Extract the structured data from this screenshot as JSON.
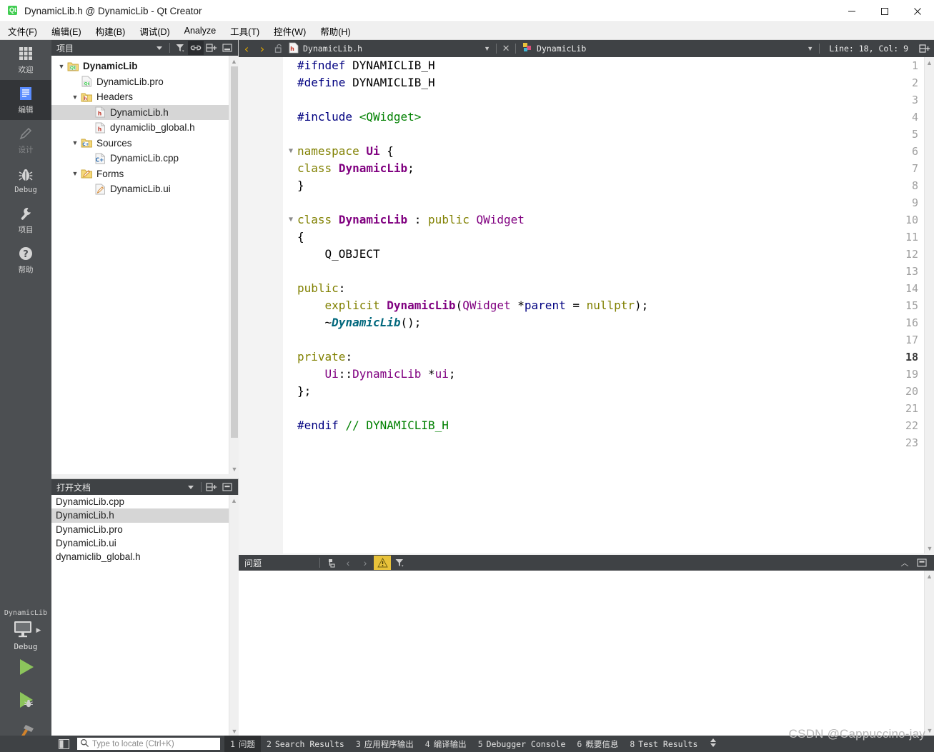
{
  "window": {
    "title": "DynamicLib.h @ DynamicLib - Qt Creator",
    "app_icon": "qt-logo-icon",
    "controls": {
      "minimize": "minimize-icon",
      "maximize": "maximize-icon",
      "close": "close-icon"
    }
  },
  "menubar": {
    "items": [
      {
        "label": "文件(F)",
        "mnemonic": "F"
      },
      {
        "label": "编辑(E)",
        "mnemonic": "E"
      },
      {
        "label": "构建(B)",
        "mnemonic": "B"
      },
      {
        "label": "调试(D)",
        "mnemonic": "D"
      },
      {
        "label": "Analyze",
        "mnemonic": "A"
      },
      {
        "label": "工具(T)",
        "mnemonic": "T"
      },
      {
        "label": "控件(W)",
        "mnemonic": "W"
      },
      {
        "label": "帮助(H)",
        "mnemonic": "H"
      }
    ]
  },
  "modebar": {
    "items": [
      {
        "label": "欢迎",
        "icon": "grid-icon",
        "selected": false,
        "enabled": true
      },
      {
        "label": "编辑",
        "icon": "document-lines-icon",
        "selected": true,
        "enabled": true
      },
      {
        "label": "设计",
        "icon": "pencil-icon",
        "selected": false,
        "enabled": false
      },
      {
        "label": "Debug",
        "icon": "bug-icon",
        "selected": false,
        "enabled": true
      },
      {
        "label": "项目",
        "icon": "wrench-icon",
        "selected": false,
        "enabled": true
      },
      {
        "label": "帮助",
        "icon": "question-circle-icon",
        "selected": false,
        "enabled": true
      }
    ],
    "kit": {
      "project_name": "DynamicLib",
      "build_config": "Debug",
      "target_icon": "desktop-monitor-icon",
      "run_button": "run-icon",
      "debug_button": "run-debug-icon",
      "build_button": "hammer-icon"
    }
  },
  "project_pane": {
    "title": "项目",
    "toolbar": [
      {
        "name": "filter-dropdown-icon",
        "active": false
      },
      {
        "name": "filter-icon",
        "active": false
      },
      {
        "name": "link-sync-icon",
        "active": true
      },
      {
        "name": "split-add-icon",
        "active": false
      },
      {
        "name": "collapse-pane-icon",
        "active": false
      }
    ],
    "tree": [
      {
        "label": "DynamicLib",
        "indent": 0,
        "arrow": "down",
        "icon": "qt-project-icon",
        "bold": true,
        "selected": false
      },
      {
        "label": "DynamicLib.pro",
        "indent": 1,
        "arrow": "",
        "icon": "qt-pro-file-icon",
        "bold": false,
        "selected": false
      },
      {
        "label": "Headers",
        "indent": 1,
        "arrow": "down",
        "icon": "folder-h-icon",
        "bold": false,
        "selected": false
      },
      {
        "label": "DynamicLib.h",
        "indent": 2,
        "arrow": "",
        "icon": "h-file-icon",
        "bold": false,
        "selected": true
      },
      {
        "label": "dynamiclib_global.h",
        "indent": 2,
        "arrow": "",
        "icon": "h-file-icon",
        "bold": false,
        "selected": false
      },
      {
        "label": "Sources",
        "indent": 1,
        "arrow": "down",
        "icon": "folder-cpp-icon",
        "bold": false,
        "selected": false
      },
      {
        "label": "DynamicLib.cpp",
        "indent": 2,
        "arrow": "",
        "icon": "cpp-file-icon",
        "bold": false,
        "selected": false
      },
      {
        "label": "Forms",
        "indent": 1,
        "arrow": "down",
        "icon": "folder-forms-icon",
        "bold": false,
        "selected": false
      },
      {
        "label": "DynamicLib.ui",
        "indent": 2,
        "arrow": "",
        "icon": "ui-file-icon",
        "bold": false,
        "selected": false
      }
    ]
  },
  "open_documents": {
    "title": "打开文档",
    "toolbar": [
      {
        "name": "dropdown-icon",
        "active": false
      },
      {
        "name": "split-add-icon",
        "active": false
      },
      {
        "name": "close-pane-icon",
        "active": false
      }
    ],
    "items": [
      {
        "label": "DynamicLib.cpp",
        "selected": false
      },
      {
        "label": "DynamicLib.h",
        "selected": true
      },
      {
        "label": "DynamicLib.pro",
        "selected": false
      },
      {
        "label": "DynamicLib.ui",
        "selected": false
      },
      {
        "label": "dynamiclib_global.h",
        "selected": false
      }
    ]
  },
  "editor": {
    "toolbar": {
      "back_icon": "nav-back-icon",
      "forward_icon": "nav-forward-icon",
      "lock_icon": "unlocked-icon",
      "file_icon": "h-file-icon",
      "file_name": "DynamicLib.h",
      "dropdown_icon": "chevron-down-icon",
      "close_icon": "close-icon",
      "symbol_icon": "qt-class-icon",
      "symbol_name": "DynamicLib",
      "symbol_dropdown_icon": "chevron-down-icon",
      "cursor_position": "Line: 18, Col: 9",
      "split_icon": "split-add-icon"
    },
    "current_line": 18,
    "total_lines": 23,
    "lines": [
      {
        "n": 1,
        "fold": "",
        "tokens": [
          {
            "t": "#ifndef",
            "c": "k-pre"
          },
          {
            "t": " DYNAMICLIB_H",
            "c": "k-plain"
          }
        ]
      },
      {
        "n": 2,
        "fold": "",
        "tokens": [
          {
            "t": "#define",
            "c": "k-pre"
          },
          {
            "t": " DYNAMICLIB_H",
            "c": "k-plain"
          }
        ]
      },
      {
        "n": 3,
        "fold": "",
        "tokens": []
      },
      {
        "n": 4,
        "fold": "",
        "tokens": [
          {
            "t": "#include",
            "c": "k-pre"
          },
          {
            "t": " ",
            "c": "k-plain"
          },
          {
            "t": "<QWidget>",
            "c": "k-str"
          }
        ]
      },
      {
        "n": 5,
        "fold": "",
        "tokens": []
      },
      {
        "n": 6,
        "fold": "v",
        "tokens": [
          {
            "t": "namespace",
            "c": "k-kw"
          },
          {
            "t": " ",
            "c": "k-plain"
          },
          {
            "t": "Ui",
            "c": "k-typeb"
          },
          {
            "t": " {",
            "c": "k-plain"
          }
        ]
      },
      {
        "n": 7,
        "fold": "",
        "tokens": [
          {
            "t": "class",
            "c": "k-kw"
          },
          {
            "t": " ",
            "c": "k-plain"
          },
          {
            "t": "DynamicLib",
            "c": "k-typeb"
          },
          {
            "t": ";",
            "c": "k-plain"
          }
        ]
      },
      {
        "n": 8,
        "fold": "",
        "tokens": [
          {
            "t": "}",
            "c": "k-plain"
          }
        ]
      },
      {
        "n": 9,
        "fold": "",
        "tokens": []
      },
      {
        "n": 10,
        "fold": "v",
        "tokens": [
          {
            "t": "class",
            "c": "k-kw"
          },
          {
            "t": " ",
            "c": "k-plain"
          },
          {
            "t": "DynamicLib",
            "c": "k-typeb"
          },
          {
            "t": " : ",
            "c": "k-plain"
          },
          {
            "t": "public",
            "c": "k-kw"
          },
          {
            "t": " ",
            "c": "k-plain"
          },
          {
            "t": "QWidget",
            "c": "k-type"
          }
        ]
      },
      {
        "n": 11,
        "fold": "",
        "tokens": [
          {
            "t": "{",
            "c": "k-plain"
          }
        ]
      },
      {
        "n": 12,
        "fold": "",
        "tokens": [
          {
            "t": "    Q_OBJECT",
            "c": "k-plain"
          }
        ]
      },
      {
        "n": 13,
        "fold": "",
        "tokens": []
      },
      {
        "n": 14,
        "fold": "",
        "tokens": [
          {
            "t": "public",
            "c": "k-kw"
          },
          {
            "t": ":",
            "c": "k-plain"
          }
        ]
      },
      {
        "n": 15,
        "fold": "",
        "tokens": [
          {
            "t": "    ",
            "c": "k-plain"
          },
          {
            "t": "explicit",
            "c": "k-kw"
          },
          {
            "t": " ",
            "c": "k-plain"
          },
          {
            "t": "DynamicLib",
            "c": "k-typeb"
          },
          {
            "t": "(",
            "c": "k-plain"
          },
          {
            "t": "QWidget",
            "c": "k-type"
          },
          {
            "t": " *",
            "c": "k-plain"
          },
          {
            "t": "parent",
            "c": "k-param"
          },
          {
            "t": " = ",
            "c": "k-plain"
          },
          {
            "t": "nullptr",
            "c": "k-kw"
          },
          {
            "t": ");",
            "c": "k-plain"
          }
        ]
      },
      {
        "n": 16,
        "fold": "",
        "tokens": [
          {
            "t": "    ~",
            "c": "k-plain"
          },
          {
            "t": "DynamicLib",
            "c": "k-fn"
          },
          {
            "t": "();",
            "c": "k-plain"
          }
        ]
      },
      {
        "n": 17,
        "fold": "",
        "tokens": []
      },
      {
        "n": 18,
        "fold": "",
        "tokens": [
          {
            "t": "private",
            "c": "k-kw"
          },
          {
            "t": ":",
            "c": "k-plain"
          }
        ]
      },
      {
        "n": 19,
        "fold": "",
        "tokens": [
          {
            "t": "    ",
            "c": "k-plain"
          },
          {
            "t": "Ui",
            "c": "k-type"
          },
          {
            "t": "::",
            "c": "k-plain"
          },
          {
            "t": "DynamicLib",
            "c": "k-type"
          },
          {
            "t": " *",
            "c": "k-plain"
          },
          {
            "t": "ui",
            "c": "k-fld"
          },
          {
            "t": ";",
            "c": "k-plain"
          }
        ]
      },
      {
        "n": 20,
        "fold": "",
        "tokens": [
          {
            "t": "};",
            "c": "k-plain"
          }
        ]
      },
      {
        "n": 21,
        "fold": "",
        "tokens": []
      },
      {
        "n": 22,
        "fold": "",
        "tokens": [
          {
            "t": "#endif",
            "c": "k-pre"
          },
          {
            "t": " ",
            "c": "k-plain"
          },
          {
            "t": "// DYNAMICLIB_H",
            "c": "k-cmt"
          }
        ]
      },
      {
        "n": 23,
        "fold": "",
        "tokens": []
      }
    ]
  },
  "issues_pane": {
    "title": "问题",
    "toolbar": [
      {
        "name": "clear-icon",
        "active": false
      },
      {
        "name": "nav-prev-icon",
        "active": false
      },
      {
        "name": "nav-next-icon",
        "active": false
      },
      {
        "name": "warning-filter-icon",
        "active": true
      },
      {
        "name": "filter-icon",
        "active": false
      }
    ],
    "right_controls": [
      {
        "name": "collapse-up-icon"
      },
      {
        "name": "close-pane-icon"
      }
    ],
    "rows": []
  },
  "statusbar": {
    "sidebar_toggle_icon": "sidebar-toggle-icon",
    "locator": {
      "icon": "search-icon",
      "placeholder": "Type to locate (Ctrl+K)",
      "value": ""
    },
    "output_tabs": [
      {
        "n": "1",
        "label": "问题",
        "selected": true
      },
      {
        "n": "2",
        "label": "Search Results",
        "selected": false
      },
      {
        "n": "3",
        "label": "应用程序输出",
        "selected": false
      },
      {
        "n": "4",
        "label": "编译输出",
        "selected": false
      },
      {
        "n": "5",
        "label": "Debugger Console",
        "selected": false
      },
      {
        "n": "6",
        "label": "概要信息",
        "selected": false
      },
      {
        "n": "8",
        "label": "Test Results",
        "selected": false
      }
    ],
    "updown_icon": "up-down-arrows-icon"
  },
  "watermark": {
    "text": "CSDN @Cappuccino-jay"
  },
  "colors": {
    "dark_chrome": "#3f4245",
    "mode_bar": "#4c4f52",
    "mode_selected": "#333538",
    "selection": "#d6d6d6",
    "accent_yellow": "#e0a800",
    "warning": "#e8c23a",
    "qt_green": "#41cd52",
    "run_green": "#7ab24d"
  }
}
